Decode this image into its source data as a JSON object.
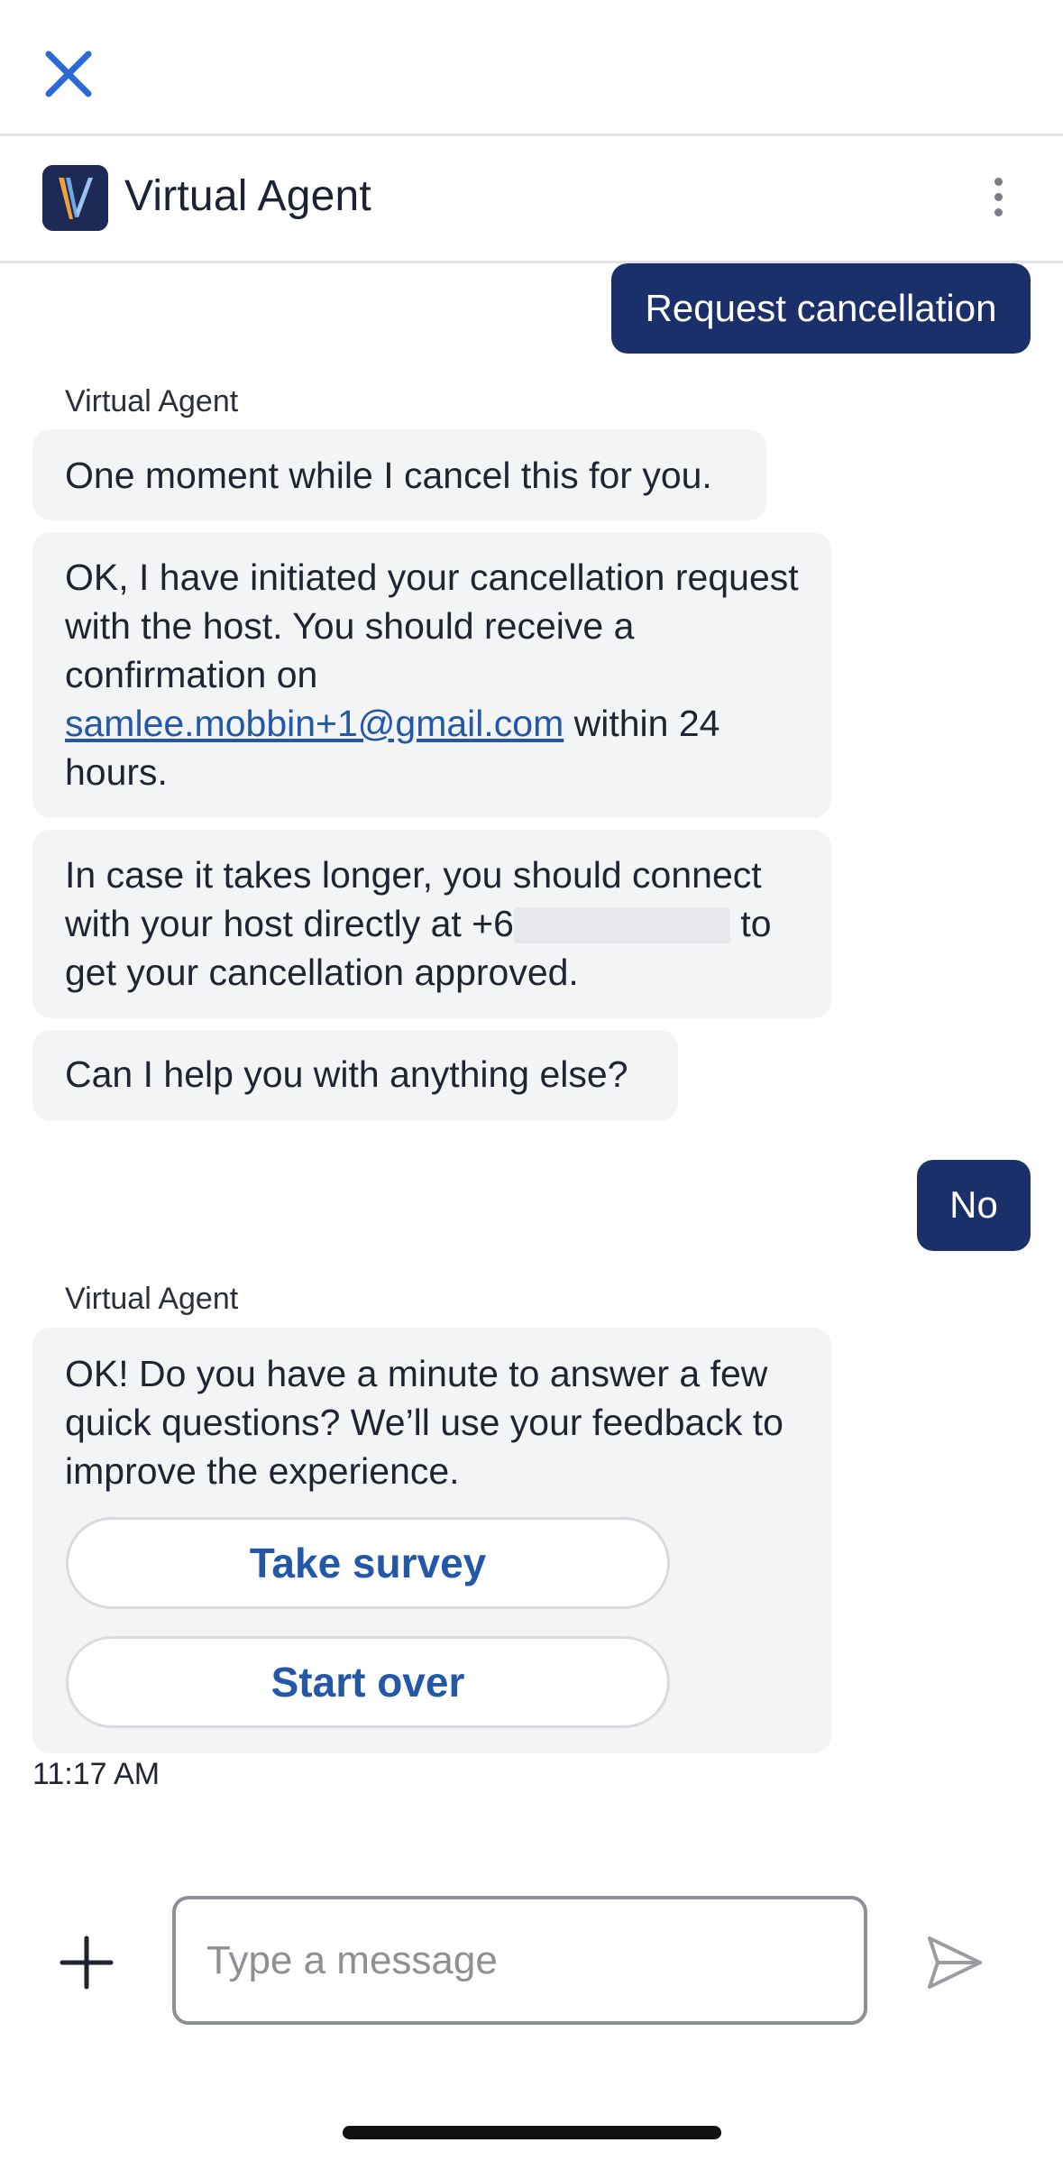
{
  "header": {
    "title": "Virtual Agent"
  },
  "messages": {
    "user_1": "Request cancellation",
    "sender_1": "Virtual Agent",
    "agent_1": "One moment while I cancel this for you.",
    "agent_2_before": "OK, I have initiated your cancellation request with the host. You should receive a confirmation on",
    "agent_2_email": "samlee.mobbin+1@gmail.com",
    "agent_2_after": "within 24 hours.",
    "agent_3_before": "In case it takes longer, you should connect with your host directly at +6",
    "agent_3_after": "to get your cancellation approved.",
    "agent_4": "Can I help you with anything else?",
    "user_2": "No",
    "sender_2": "Virtual Agent",
    "agent_5": "OK! Do you have a minute to answer a few quick questions? We’ll use your feedback to improve the experience.",
    "take_survey": "Take survey",
    "start_over": "Start over",
    "timestamp": "11:17 AM"
  },
  "composer": {
    "placeholder": "Type a message"
  },
  "colors": {
    "user_bubble": "#1b2f6b",
    "agent_bubble": "#f3f4f6",
    "accent": "#2357a8",
    "close_icon": "#2a6ad8"
  },
  "icons": {
    "close": "close-icon",
    "menu": "more-vertical-icon",
    "add": "plus-icon",
    "send": "send-icon"
  }
}
